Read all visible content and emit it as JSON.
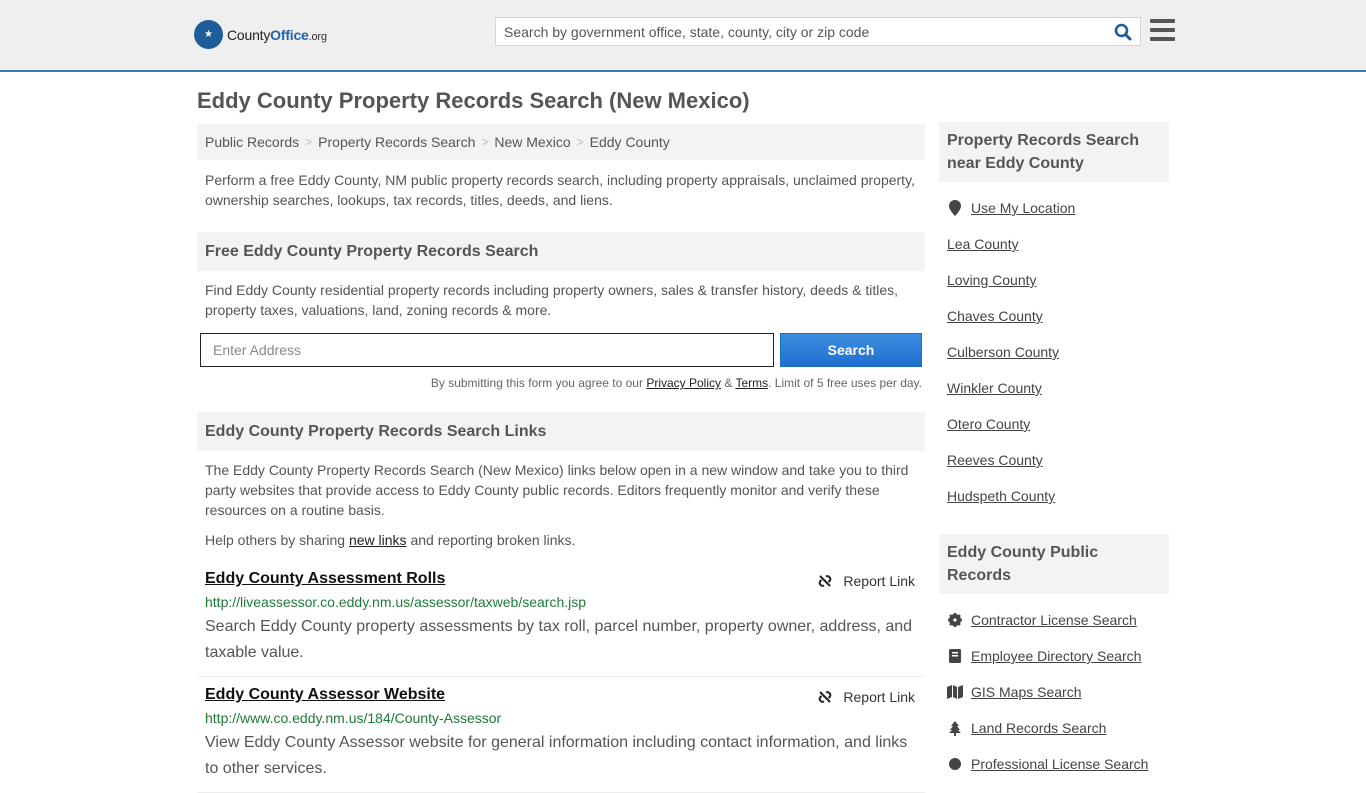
{
  "header": {
    "logo": {
      "prefix": "County",
      "brand": "Office",
      "suffix": ".org"
    },
    "search_placeholder": "Search by government office, state, county, city or zip code",
    "search_icon": "search-icon",
    "menu_icon": "hamburger-menu-icon"
  },
  "page_title": "Eddy County Property Records Search (New Mexico)",
  "breadcrumb": [
    {
      "label": "Public Records"
    },
    {
      "label": "Property Records Search"
    },
    {
      "label": "New Mexico"
    },
    {
      "label": "Eddy County"
    }
  ],
  "intro": "Perform a free Eddy County, NM public property records search, including property appraisals, unclaimed property, ownership searches, lookups, tax records, titles, deeds, and liens.",
  "free_search": {
    "heading": "Free Eddy County Property Records Search",
    "description": "Find Eddy County residential property records including property owners, sales & transfer history, deeds & titles, property taxes, valuations, land, zoning records & more.",
    "address_placeholder": "Enter Address",
    "button_label": "Search",
    "disclaimer_prefix": "By submitting this form you agree to our ",
    "privacy_label": "Privacy Policy",
    "amp": " & ",
    "terms_label": "Terms",
    "disclaimer_suffix": ". Limit of 5 free uses per day."
  },
  "links_section": {
    "heading": "Eddy County Property Records Search Links",
    "description": "The Eddy County Property Records Search (New Mexico) links below open in a new window and take you to third party websites that provide access to Eddy County public records. Editors frequently monitor and verify these resources on a routine basis.",
    "help_prefix": "Help others by sharing ",
    "help_link": "new links",
    "help_suffix": " and reporting broken links.",
    "report_label": "Report Link",
    "items": [
      {
        "title": "Eddy County Assessment Rolls",
        "url": "http://liveassessor.co.eddy.nm.us/assessor/taxweb/search.jsp",
        "description": "Search Eddy County property assessments by tax roll, parcel number, property owner, address, and taxable value."
      },
      {
        "title": "Eddy County Assessor Website",
        "url": "http://www.co.eddy.nm.us/184/County-Assessor",
        "description": "View Eddy County Assessor website for general information including contact information, and links to other services."
      }
    ]
  },
  "sidebar": {
    "nearby_heading": "Property Records Search near Eddy County",
    "use_location": "Use My Location",
    "nearby": [
      "Lea County",
      "Loving County",
      "Chaves County",
      "Culberson County",
      "Winkler County",
      "Otero County",
      "Reeves County",
      "Hudspeth County"
    ],
    "public_heading": "Eddy County Public Records",
    "public_records": [
      {
        "label": "Contractor License Search",
        "icon": "gear-icon"
      },
      {
        "label": "Employee Directory Search",
        "icon": "book-icon"
      },
      {
        "label": "GIS Maps Search",
        "icon": "map-icon"
      },
      {
        "label": "Land Records Search",
        "icon": "tree-icon"
      },
      {
        "label": "Professional License Search",
        "icon": "badge-icon"
      }
    ]
  }
}
